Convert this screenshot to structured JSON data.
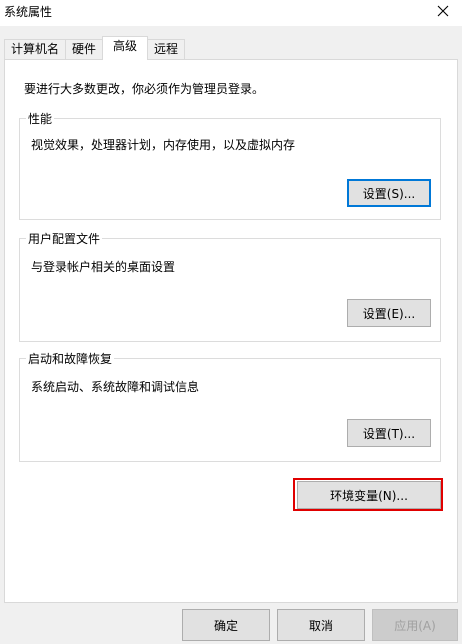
{
  "window": {
    "title": "系统属性"
  },
  "tabs": [
    {
      "label": "计算机名"
    },
    {
      "label": "硬件"
    },
    {
      "label": "高级"
    },
    {
      "label": "远程"
    }
  ],
  "notice": "要进行大多数更改，你必须作为管理员登录。",
  "performance": {
    "legend": "性能",
    "description": "视觉效果，处理器计划，内存使用，以及虚拟内存",
    "button": "设置(S)..."
  },
  "user_profiles": {
    "legend": "用户配置文件",
    "description": "与登录帐户相关的桌面设置",
    "button": "设置(E)..."
  },
  "startup_recovery": {
    "legend": "启动和故障恢复",
    "description": "系统启动、系统故障和调试信息",
    "button": "设置(T)..."
  },
  "env_button": "环境变量(N)...",
  "footer": {
    "ok": "确定",
    "cancel": "取消",
    "apply": "应用(A)"
  },
  "colors": {
    "highlight": "#e00000",
    "focus": "#0078d7"
  },
  "icons": {
    "close": "close-icon"
  }
}
